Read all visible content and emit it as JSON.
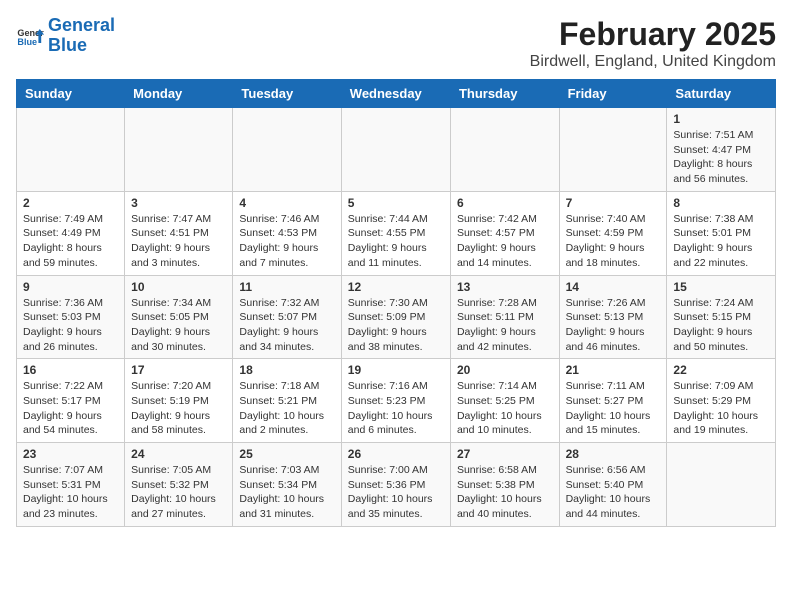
{
  "header": {
    "logo_line1": "General",
    "logo_line2": "Blue",
    "title": "February 2025",
    "subtitle": "Birdwell, England, United Kingdom"
  },
  "columns": [
    "Sunday",
    "Monday",
    "Tuesday",
    "Wednesday",
    "Thursday",
    "Friday",
    "Saturday"
  ],
  "weeks": [
    {
      "days": [
        {
          "num": "",
          "info": ""
        },
        {
          "num": "",
          "info": ""
        },
        {
          "num": "",
          "info": ""
        },
        {
          "num": "",
          "info": ""
        },
        {
          "num": "",
          "info": ""
        },
        {
          "num": "",
          "info": ""
        },
        {
          "num": "1",
          "info": "Sunrise: 7:51 AM\nSunset: 4:47 PM\nDaylight: 8 hours and 56 minutes."
        }
      ]
    },
    {
      "days": [
        {
          "num": "2",
          "info": "Sunrise: 7:49 AM\nSunset: 4:49 PM\nDaylight: 8 hours and 59 minutes."
        },
        {
          "num": "3",
          "info": "Sunrise: 7:47 AM\nSunset: 4:51 PM\nDaylight: 9 hours and 3 minutes."
        },
        {
          "num": "4",
          "info": "Sunrise: 7:46 AM\nSunset: 4:53 PM\nDaylight: 9 hours and 7 minutes."
        },
        {
          "num": "5",
          "info": "Sunrise: 7:44 AM\nSunset: 4:55 PM\nDaylight: 9 hours and 11 minutes."
        },
        {
          "num": "6",
          "info": "Sunrise: 7:42 AM\nSunset: 4:57 PM\nDaylight: 9 hours and 14 minutes."
        },
        {
          "num": "7",
          "info": "Sunrise: 7:40 AM\nSunset: 4:59 PM\nDaylight: 9 hours and 18 minutes."
        },
        {
          "num": "8",
          "info": "Sunrise: 7:38 AM\nSunset: 5:01 PM\nDaylight: 9 hours and 22 minutes."
        }
      ]
    },
    {
      "days": [
        {
          "num": "9",
          "info": "Sunrise: 7:36 AM\nSunset: 5:03 PM\nDaylight: 9 hours and 26 minutes."
        },
        {
          "num": "10",
          "info": "Sunrise: 7:34 AM\nSunset: 5:05 PM\nDaylight: 9 hours and 30 minutes."
        },
        {
          "num": "11",
          "info": "Sunrise: 7:32 AM\nSunset: 5:07 PM\nDaylight: 9 hours and 34 minutes."
        },
        {
          "num": "12",
          "info": "Sunrise: 7:30 AM\nSunset: 5:09 PM\nDaylight: 9 hours and 38 minutes."
        },
        {
          "num": "13",
          "info": "Sunrise: 7:28 AM\nSunset: 5:11 PM\nDaylight: 9 hours and 42 minutes."
        },
        {
          "num": "14",
          "info": "Sunrise: 7:26 AM\nSunset: 5:13 PM\nDaylight: 9 hours and 46 minutes."
        },
        {
          "num": "15",
          "info": "Sunrise: 7:24 AM\nSunset: 5:15 PM\nDaylight: 9 hours and 50 minutes."
        }
      ]
    },
    {
      "days": [
        {
          "num": "16",
          "info": "Sunrise: 7:22 AM\nSunset: 5:17 PM\nDaylight: 9 hours and 54 minutes."
        },
        {
          "num": "17",
          "info": "Sunrise: 7:20 AM\nSunset: 5:19 PM\nDaylight: 9 hours and 58 minutes."
        },
        {
          "num": "18",
          "info": "Sunrise: 7:18 AM\nSunset: 5:21 PM\nDaylight: 10 hours and 2 minutes."
        },
        {
          "num": "19",
          "info": "Sunrise: 7:16 AM\nSunset: 5:23 PM\nDaylight: 10 hours and 6 minutes."
        },
        {
          "num": "20",
          "info": "Sunrise: 7:14 AM\nSunset: 5:25 PM\nDaylight: 10 hours and 10 minutes."
        },
        {
          "num": "21",
          "info": "Sunrise: 7:11 AM\nSunset: 5:27 PM\nDaylight: 10 hours and 15 minutes."
        },
        {
          "num": "22",
          "info": "Sunrise: 7:09 AM\nSunset: 5:29 PM\nDaylight: 10 hours and 19 minutes."
        }
      ]
    },
    {
      "days": [
        {
          "num": "23",
          "info": "Sunrise: 7:07 AM\nSunset: 5:31 PM\nDaylight: 10 hours and 23 minutes."
        },
        {
          "num": "24",
          "info": "Sunrise: 7:05 AM\nSunset: 5:32 PM\nDaylight: 10 hours and 27 minutes."
        },
        {
          "num": "25",
          "info": "Sunrise: 7:03 AM\nSunset: 5:34 PM\nDaylight: 10 hours and 31 minutes."
        },
        {
          "num": "26",
          "info": "Sunrise: 7:00 AM\nSunset: 5:36 PM\nDaylight: 10 hours and 35 minutes."
        },
        {
          "num": "27",
          "info": "Sunrise: 6:58 AM\nSunset: 5:38 PM\nDaylight: 10 hours and 40 minutes."
        },
        {
          "num": "28",
          "info": "Sunrise: 6:56 AM\nSunset: 5:40 PM\nDaylight: 10 hours and 44 minutes."
        },
        {
          "num": "",
          "info": ""
        }
      ]
    }
  ]
}
